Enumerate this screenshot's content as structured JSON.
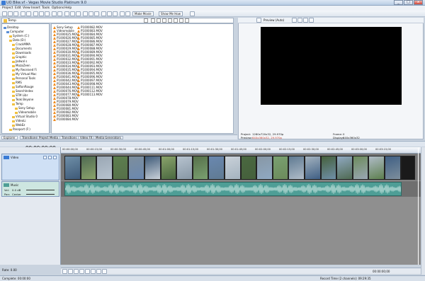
{
  "window": {
    "title": "UO Bike.vf - Vegas Movie Studio Platinum 9.0",
    "min": "_",
    "max": "□",
    "close": "x"
  },
  "menu": [
    "Project",
    "Edit",
    "View",
    "Insert",
    "Tools",
    "Options",
    "Help"
  ],
  "toolbar": {
    "make_movie": "Make Movie",
    "show_me_how": "Show Me How"
  },
  "explorer": {
    "path": "Temp",
    "tree": [
      {
        "label": "Desktop",
        "indent": 0
      },
      {
        "label": "Computer",
        "indent": 1
      },
      {
        "label": "System (C:)",
        "indent": 2
      },
      {
        "label": "Data (D:)",
        "indent": 2
      },
      {
        "label": "CrackMMA",
        "indent": 3
      },
      {
        "label": "Documents",
        "indent": 3
      },
      {
        "label": "Downloads",
        "indent": 3
      },
      {
        "label": "Graphic",
        "indent": 3
      },
      {
        "label": "Jadwal s",
        "indent": 3
      },
      {
        "label": "MozaZeen",
        "indent": 3
      },
      {
        "label": "My Received Fi",
        "indent": 3
      },
      {
        "label": "My Virtual Mac",
        "indent": 3
      },
      {
        "label": "Personal Tools",
        "indent": 3
      },
      {
        "label": "RMS",
        "indent": 3
      },
      {
        "label": "SaftonRouge",
        "indent": 3
      },
      {
        "label": "SearchIndex",
        "indent": 3
      },
      {
        "label": "STM Libr",
        "indent": 3
      },
      {
        "label": "Teak Beyone",
        "indent": 3
      },
      {
        "label": "Temp",
        "indent": 3
      },
      {
        "label": "Sony Setup",
        "indent": 4
      },
      {
        "label": "Videomobile",
        "indent": 4
      },
      {
        "label": "Virtual Studio 0",
        "indent": 3
      },
      {
        "label": "VideoLi",
        "indent": 3
      },
      {
        "label": "WebEz",
        "indent": 3
      },
      {
        "label": "Passport (F:)",
        "indent": 2
      }
    ],
    "files_col1": [
      "Sony Setup",
      "Videomobile",
      "P1000025.MOV",
      "P1000026.MOV",
      "P1000027.MOV",
      "P1000028.MOV",
      "P1000029.MOV",
      "P1000030.MOV",
      "P1000031.MOV",
      "P1000032.MOV",
      "P1000033.MOV",
      "P1000034.MOV",
      "P1000035.MOV",
      "P1000036.MOV",
      "P1000041.MOV",
      "P1000042.MOV",
      "P1000043.MOV",
      "P1000044.MOV",
      "P1000076.MOV",
      "P1000077.MOV",
      "P1000078.MOV",
      "P1000079.MOV",
      "P1000080.MOV",
      "P1000081.MOV",
      "P1000082.MOV",
      "P1000083.MOV",
      "P1000084.MOV"
    ],
    "files_col2": [
      "P1000082.MOV",
      "P1000083.MOV",
      "P1000084.MOV",
      "P1000085.MOV",
      "P1000086.MOV",
      "P1000087.MOV",
      "P1000088.MOV",
      "P1000089.MOV",
      "P1000090.MOV",
      "P1000091.MOV",
      "P1000092.MOV",
      "P1000093.MOV",
      "P1000094.MOV",
      "P1000095.MOV",
      "P1000096.MOV",
      "P1000097.MOV",
      "P1000098.MOV",
      "P1000111.MOV",
      "P1000112.MOV",
      "P1000113.MOV"
    ]
  },
  "tabs": [
    "Explorer",
    "Transitions",
    "Project Media",
    "Transitions",
    "Video FX",
    "Media Generators"
  ],
  "preview": {
    "mode": "Preview (Auto)",
    "project_label": "Project:",
    "project": "1280x720x32, 29.970p",
    "preview_label": "Preview:",
    "preview_val": "640x360x32, 29.970p",
    "frame_label": "Frame:",
    "frame": "0",
    "display_label": "Display:",
    "display": "640x360x32"
  },
  "timeline": {
    "timecode": "00:00:00;00",
    "ruler": [
      "00:00:00;00",
      "00:00:15;00",
      "00:00:30;00",
      "00:00:45;00",
      "00:01:00;00",
      "00:01:15;00",
      "00:01:30;00",
      "00:01:45;00",
      "00:02:00;00",
      "00:02:15;00",
      "00:02:30;00",
      "00:02:45;00",
      "00:03:00;00",
      "00:03:15;00"
    ],
    "video_track": {
      "name": "Video",
      "level": "Level: 100.0 %"
    },
    "audio_track": {
      "name": "Music",
      "vol_label": "Vol:",
      "vol": "0.0 dB",
      "pan_label": "Pan:",
      "pan": "Center"
    },
    "rate": "Rate: 0.00",
    "end_time": "00:00:00;00"
  },
  "status": {
    "left": "Complete: 00:00:00",
    "right": "Record Time (2 channels): 09:29:35"
  },
  "colors": {
    "accent": "#3a7bd5",
    "audio_clip": "#4e9e96",
    "video_bg": "#777777"
  }
}
